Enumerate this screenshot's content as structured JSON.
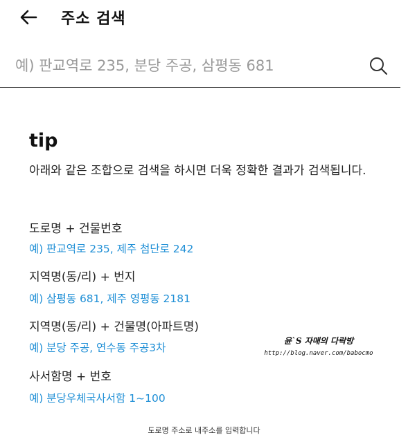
{
  "header": {
    "title": "주소 검색"
  },
  "search": {
    "placeholder": "예) 판교역로 235, 분당 주공, 삼평동 681"
  },
  "tip": {
    "heading": "tip",
    "description": "아래와 같은 조합으로 검색을 하시면 더욱 정확한 결과가 검색됩니다.",
    "examples": [
      {
        "label": "도로명 + 건물번호",
        "example": "예) 판교역로 235,  제주 첨단로 242"
      },
      {
        "label": "지역명(동/리) + 번지",
        "example": "예) 삼평동 681,  제주 영평동 2181"
      },
      {
        "label": "지역명(동/리) + 건물명(아파트명)",
        "example": "예) 분당 주공,  연수동 주공3차"
      },
      {
        "label": "사서함명 + 번호",
        "example": "예) 분당우체국사서함 1~100"
      }
    ]
  },
  "watermark": {
    "line1": "윤`S 자매의 다락방",
    "line2": "http://blog.naver.com/babocmo"
  },
  "caption": "도로명 주소로 내주소를 입력합니다"
}
